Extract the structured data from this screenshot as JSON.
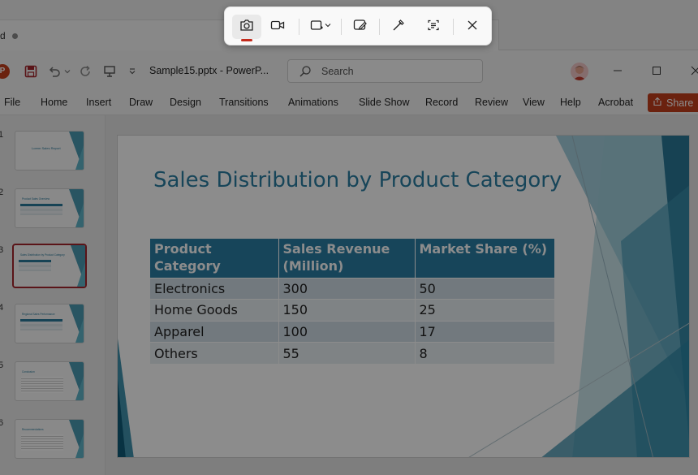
{
  "background_window": {
    "tab_fragment": "d"
  },
  "titlebar": {
    "filename": "Sample15.pptx  -  PowerP...",
    "search_placeholder": "Search"
  },
  "ribbon": {
    "tabs": [
      "File",
      "Home",
      "Insert",
      "Draw",
      "Design",
      "Transitions",
      "Animations",
      "Slide Show",
      "Record",
      "Review",
      "View",
      "Help",
      "Acrobat"
    ],
    "share_label": "Share"
  },
  "thumbnails": [
    {
      "num": "1",
      "title": "Lorem Sales Report"
    },
    {
      "num": "2",
      "title": "Product Sales Overview"
    },
    {
      "num": "3",
      "title": "Sales Distribution by Product Category",
      "selected": true
    },
    {
      "num": "4",
      "title": "Regional Sales Performance"
    },
    {
      "num": "5",
      "title": "Conclusion"
    },
    {
      "num": "6",
      "title": "Recommendations"
    }
  ],
  "slide": {
    "title": "Sales Distribution by Product Category",
    "table": {
      "headers": [
        "Product Category",
        "Sales Revenue (Million)",
        "Market Share (%)"
      ],
      "rows": [
        [
          "Electronics",
          "300",
          "50"
        ],
        [
          "Home Goods",
          "150",
          "25"
        ],
        [
          "Apparel",
          "100",
          "17"
        ],
        [
          "Others",
          "55",
          "8"
        ]
      ]
    }
  },
  "snipping_toolbar": {
    "tools": [
      "camera-icon",
      "video-icon",
      "rectangle-mode-icon",
      "edit-image-icon",
      "color-picker-icon",
      "text-actions-icon",
      "close-icon"
    ]
  },
  "colors": {
    "accent_red": "#c43e1c",
    "slide_accent": "#2b7fa5",
    "thumbnail_selected_border": "#a4262c",
    "record_indicator": "#c42b1c"
  }
}
